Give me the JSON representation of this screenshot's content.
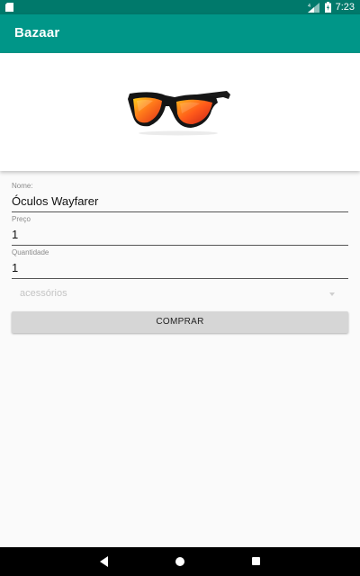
{
  "status_bar": {
    "time": "7:23",
    "icons": [
      "sd-card-icon",
      "signal-icon",
      "battery-icon"
    ]
  },
  "app_bar": {
    "title": "Bazaar",
    "color": "#009688"
  },
  "product": {
    "image_icon": "sunglasses-image"
  },
  "form": {
    "name_label": "Nome:",
    "name_value": "Óculos Wayfarer",
    "price_label": "Preço",
    "price_value": "1",
    "quantity_label": "Quantidade",
    "quantity_value": "1",
    "category_value": "acessórios",
    "buy_label": "COMPRAR"
  },
  "nav_bar": {
    "icons": [
      "back-icon",
      "home-icon",
      "recents-icon"
    ]
  }
}
